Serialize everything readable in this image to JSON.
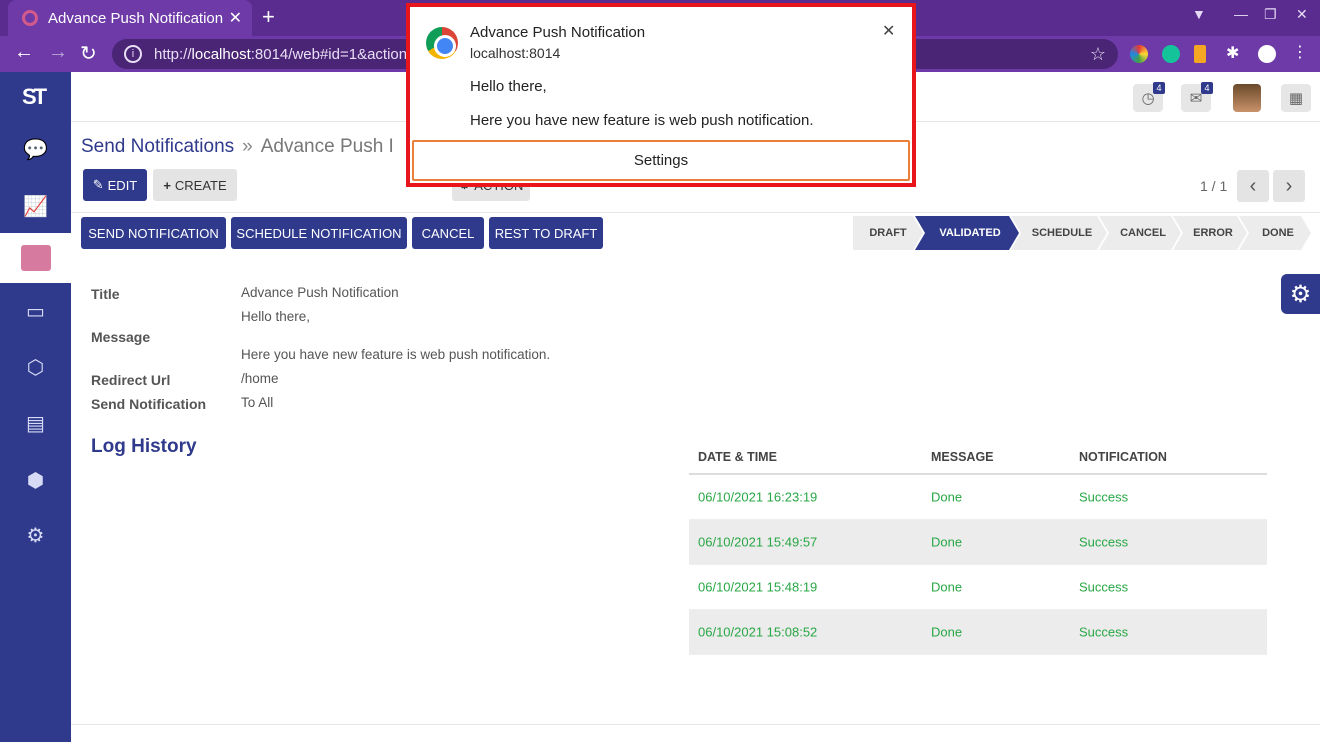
{
  "browser": {
    "tab_title": "Advance Push Notification",
    "tab_close": "✕",
    "new_tab": "+",
    "url_prefix": "http://",
    "url_host": "localhost",
    "url_rest": ":8014/web#id=1&action=",
    "back": "←",
    "forward": "→",
    "reload": "↻",
    "bookmark": "☆"
  },
  "header": {
    "activity_count": "4",
    "messages_count": "4"
  },
  "breadcrumb": {
    "parent": "Send Notifications",
    "separator": "»",
    "current": "Advance Push I"
  },
  "control": {
    "edit": "EDIT",
    "create": "CREATE",
    "action": "ACTION",
    "pager": "1 / 1"
  },
  "form_buttons": {
    "send": "SEND NOTIFICATION",
    "schedule": "SCHEDULE NOTIFICATION",
    "cancel": "CANCEL",
    "reset": "REST TO DRAFT"
  },
  "status_stages": [
    "DRAFT",
    "VALIDATED",
    "SCHEDULE",
    "CANCEL",
    "ERROR",
    "DONE"
  ],
  "active_stage": "VALIDATED",
  "form": {
    "title_label": "Title",
    "title_value": "Advance Push Notification",
    "message_label": "Message",
    "message_line1": "Hello there,",
    "message_line2": "Here you have new feature is web push notification.",
    "redirect_label": "Redirect Url",
    "redirect_value": "/home",
    "send_label": "Send Notification",
    "send_value": "To All"
  },
  "log": {
    "title": "Log History",
    "columns": [
      "DATE & TIME",
      "MESSAGE",
      "NOTIFICATION"
    ],
    "rows": [
      {
        "datetime": "06/10/2021 16:23:19",
        "message": "Done",
        "notification": "Success"
      },
      {
        "datetime": "06/10/2021 15:49:57",
        "message": "Done",
        "notification": "Success"
      },
      {
        "datetime": "06/10/2021 15:48:19",
        "message": "Done",
        "notification": "Success"
      },
      {
        "datetime": "06/10/2021 15:08:52",
        "message": "Done",
        "notification": "Success"
      }
    ]
  },
  "notification_popup": {
    "title": "Advance Push Notification",
    "host": "localhost:8014",
    "line1": "Hello there,",
    "line2": "Here you have new feature is web push notification.",
    "settings": "Settings",
    "close": "✕"
  },
  "colors": {
    "brand": "#2f3a8c",
    "browser": "#6d3aa7",
    "success": "#28a745",
    "highlight": "#e8161a"
  }
}
